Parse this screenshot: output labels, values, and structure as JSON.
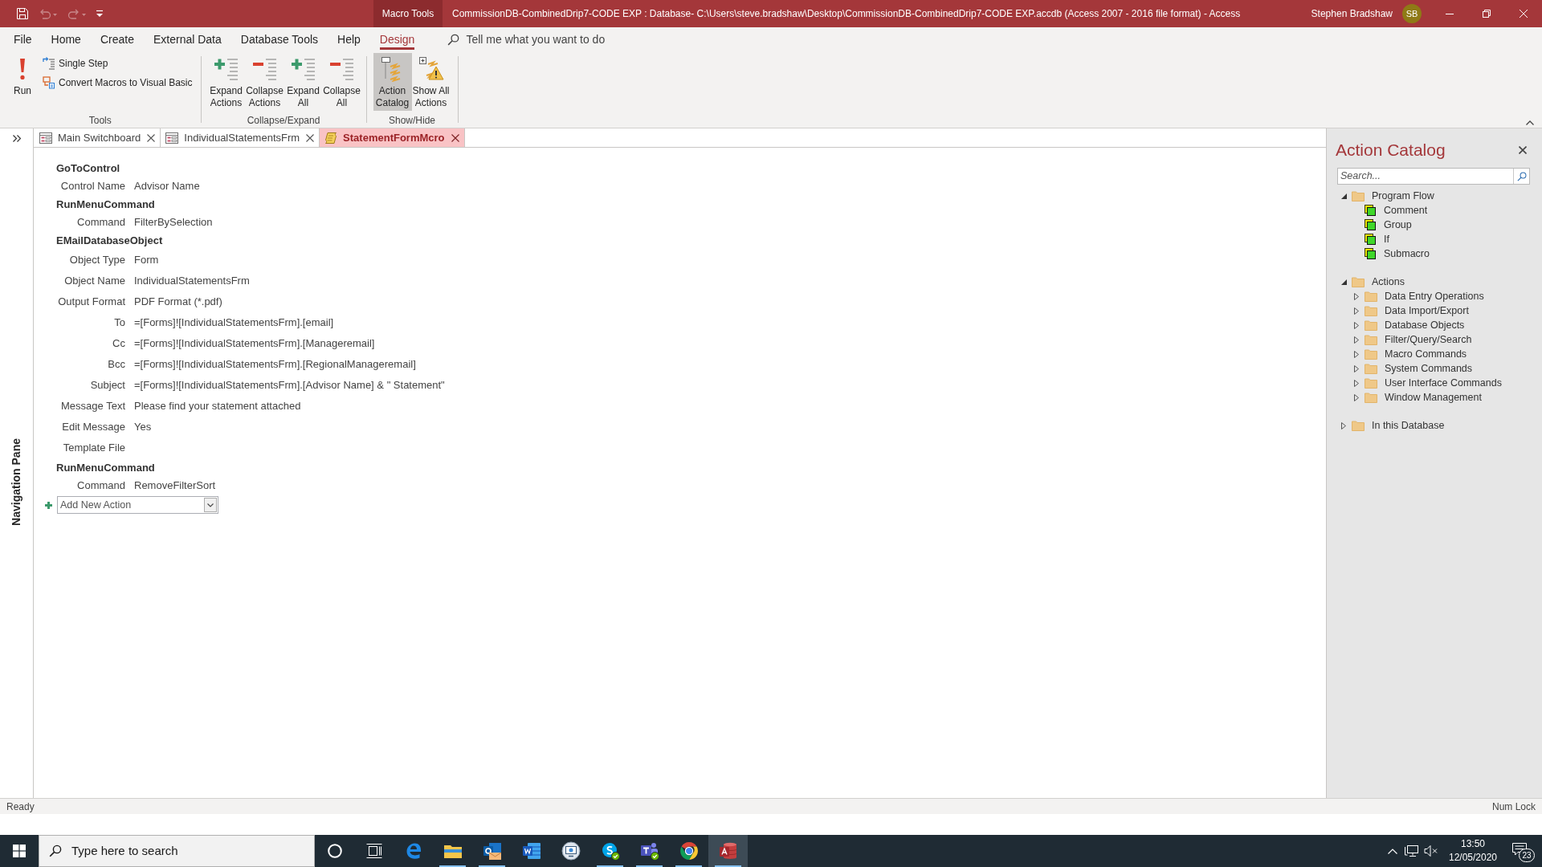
{
  "title_bar": {
    "quick_access": [
      {
        "kind": "save",
        "disabled": false
      },
      {
        "kind": "undo",
        "disabled": true
      },
      {
        "kind": "redo",
        "disabled": true
      },
      {
        "kind": "customize",
        "disabled": false
      }
    ],
    "context_tab": "Macro Tools",
    "title": "CommissionDB-CombinedDrip7-CODE EXP : Database- C:\\Users\\steve.bradshaw\\Desktop\\CommissionDB-CombinedDrip7-CODE EXP.accdb (Access 2007 - 2016 file format) - Access",
    "user": "Stephen Bradshaw",
    "initials": "SB"
  },
  "ribbon": {
    "tabs": [
      {
        "label": "File",
        "selected": false
      },
      {
        "label": "Home",
        "selected": false
      },
      {
        "label": "Create",
        "selected": false
      },
      {
        "label": "External Data",
        "selected": false
      },
      {
        "label": "Database Tools",
        "selected": false
      },
      {
        "label": "Help",
        "selected": false
      },
      {
        "label": "Design",
        "selected": true
      }
    ],
    "tell_me": {
      "placeholder": "Tell me what you want to do"
    },
    "groups": [
      {
        "label": "Tools",
        "buttons": [
          {
            "label": "Run",
            "kind": "large"
          },
          {
            "label": "Single Step",
            "kind": "small"
          },
          {
            "label": "Convert Macros to Visual Basic",
            "kind": "small"
          }
        ]
      },
      {
        "label": "Collapse/Expand",
        "buttons": [
          {
            "label": "Expand Actions",
            "kind": "large"
          },
          {
            "label": "Collapse Actions",
            "kind": "large"
          },
          {
            "label": "Expand All",
            "kind": "large"
          },
          {
            "label": "Collapse All",
            "kind": "large"
          }
        ]
      },
      {
        "label": "Show/Hide",
        "buttons": [
          {
            "label": "Action Catalog",
            "kind": "large",
            "selected": true
          },
          {
            "label": "Show All Actions",
            "kind": "large",
            "selected": false
          }
        ]
      }
    ]
  },
  "navigation_pane": {
    "label": "Navigation Pane"
  },
  "document_tabs": [
    {
      "label": "Main Switchboard",
      "kind": "form",
      "selected": false
    },
    {
      "label": "IndividualStatementsFrm",
      "kind": "form",
      "selected": false
    },
    {
      "label": "StatementFormMcro",
      "kind": "macro",
      "selected": true
    }
  ],
  "macro": {
    "actions": [
      {
        "name": "GoToControl",
        "arguments": [
          {
            "label": "Control Name",
            "value": "Advisor Name"
          }
        ]
      },
      {
        "name": "RunMenuCommand",
        "arguments": [
          {
            "label": "Command",
            "value": "FilterBySelection"
          }
        ]
      },
      {
        "name": "EMailDatabaseObject",
        "arguments": [
          {
            "label": "Object Type",
            "value": "Form"
          },
          {
            "label": "Object Name",
            "value": "IndividualStatementsFrm"
          },
          {
            "label": "Output Format",
            "value": "PDF Format (*.pdf)"
          },
          {
            "label": "To",
            "value": "=[Forms]![IndividualStatementsFrm].[email]"
          },
          {
            "label": "Cc",
            "value": "=[Forms]![IndividualStatementsFrm].[Manageremail]"
          },
          {
            "label": "Bcc",
            "value": "=[Forms]![IndividualStatementsFrm].[RegionalManageremail]"
          },
          {
            "label": "Subject",
            "value": "=[Forms]![IndividualStatementsFrm].[Advisor Name] & \" Statement\""
          },
          {
            "label": "Message Text",
            "value": "Please find your statement attached"
          },
          {
            "label": "Edit Message",
            "value": "Yes"
          },
          {
            "label": "Template File"
          }
        ]
      },
      {
        "name": "RunMenuCommand",
        "arguments": [
          {
            "label": "Command",
            "value": "RemoveFilterSort"
          }
        ]
      }
    ],
    "add_action": {
      "placeholder": "Add New Action"
    }
  },
  "action_catalog": {
    "title": "Action Catalog",
    "search": {
      "placeholder": "Search..."
    },
    "tree": [
      {
        "label": "Program Flow",
        "kind": "folder",
        "expanded": true,
        "children": [
          {
            "label": "Comment",
            "kind": "action"
          },
          {
            "label": "Group",
            "kind": "action"
          },
          {
            "label": "If",
            "kind": "action"
          },
          {
            "label": "Submacro",
            "kind": "action"
          }
        ]
      },
      {
        "label": "Actions",
        "kind": "folder",
        "expanded": true,
        "children": [
          {
            "label": "Data Entry Operations",
            "kind": "folder",
            "expanded": false
          },
          {
            "label": "Data Import/Export",
            "kind": "folder",
            "expanded": false
          },
          {
            "label": "Database Objects",
            "kind": "folder",
            "expanded": false
          },
          {
            "label": "Filter/Query/Search",
            "kind": "folder",
            "expanded": false
          },
          {
            "label": "Macro Commands",
            "kind": "folder",
            "expanded": false
          },
          {
            "label": "System Commands",
            "kind": "folder",
            "expanded": false
          },
          {
            "label": "User Interface Commands",
            "kind": "folder",
            "expanded": false
          },
          {
            "label": "Window Management",
            "kind": "folder",
            "expanded": false
          }
        ]
      },
      {
        "label": "In this Database",
        "kind": "folder",
        "expanded": false
      }
    ]
  },
  "status_bar": {
    "status": "Ready",
    "indicator": "Num Lock"
  },
  "taskbar": {
    "search": {
      "placeholder": "Type here to search"
    },
    "apps": [
      {
        "running": false,
        "selected": false
      },
      {
        "running": true,
        "selected": false
      },
      {
        "running": true,
        "selected": false
      },
      {
        "running": false,
        "selected": false
      },
      {
        "running": false,
        "selected": false
      },
      {
        "running": true,
        "selected": false
      },
      {
        "running": true,
        "selected": false
      },
      {
        "running": true,
        "selected": false
      },
      {
        "running": true,
        "selected": true
      }
    ],
    "clock": {
      "time": "13:50",
      "date": "12/05/2020"
    },
    "notification_count": "23"
  }
}
